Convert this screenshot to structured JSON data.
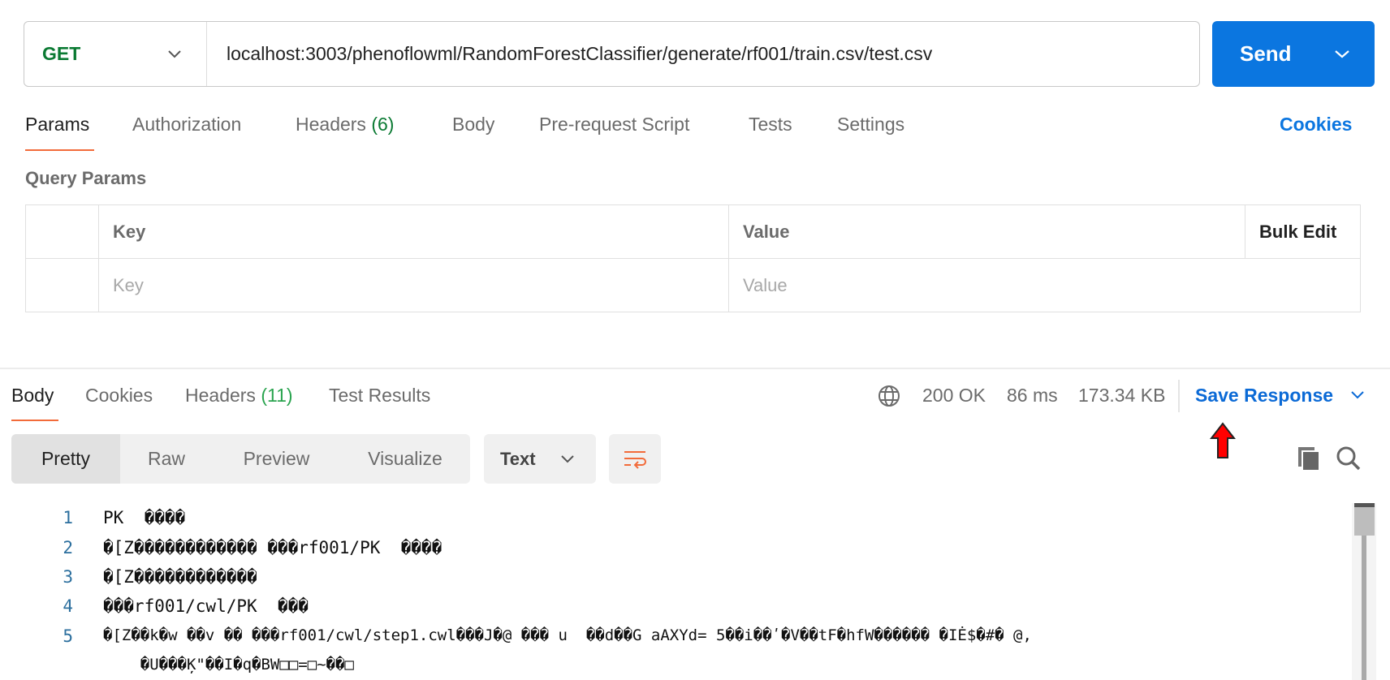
{
  "request": {
    "method": "GET",
    "url": "localhost:3003/phenoflowml/RandomForestClassifier/generate/rf001/train.csv/test.csv",
    "send_label": "Send"
  },
  "tabs": [
    {
      "label": "Params"
    },
    {
      "label": "Authorization"
    },
    {
      "label": "Headers",
      "count": "(6)"
    },
    {
      "label": "Body"
    },
    {
      "label": "Pre-request Script"
    },
    {
      "label": "Tests"
    },
    {
      "label": "Settings"
    }
  ],
  "cookies_link": "Cookies",
  "query_params": {
    "title": "Query Params",
    "headers": [
      "Key",
      "Value",
      "Bulk Edit"
    ],
    "placeholders": {
      "key": "Key",
      "value": "Value"
    }
  },
  "response": {
    "tabs": [
      {
        "label": "Body"
      },
      {
        "label": "Cookies"
      },
      {
        "label": "Headers",
        "count": "(11)"
      },
      {
        "label": "Test Results"
      }
    ],
    "status": "200 OK",
    "time": "86 ms",
    "size": "173.34 KB",
    "save_label": "Save Response",
    "views": [
      "Pretty",
      "Raw",
      "Preview",
      "Visualize"
    ],
    "format": "Text",
    "lines": [
      {
        "n": "1",
        "text": "PK  ����"
      },
      {
        "n": "2",
        "text": "�[Z������������ ���rf001/PK  ����"
      },
      {
        "n": "3",
        "text": "�[Z������������"
      },
      {
        "n": "4",
        "text": "���rf001/cwl/PK  ���"
      },
      {
        "n": "5",
        "text": "�[Z��k�w ��v �� ���rf001/cwl/step1.cwl���J�@ ��� u  ��d��G aAXYd= 5��i��ʹ�V��tF�hfW������ �IĖ$�#� @,"
      },
      {
        "n": "",
        "text": "    �U���Ķ\"��I�q�BW□□=□~��□"
      }
    ]
  },
  "colors": {
    "accent": "#0b76e0",
    "success": "#0b7a33",
    "tab_underline": "#f26b3a",
    "annotation_arrow": "#ff0000"
  }
}
